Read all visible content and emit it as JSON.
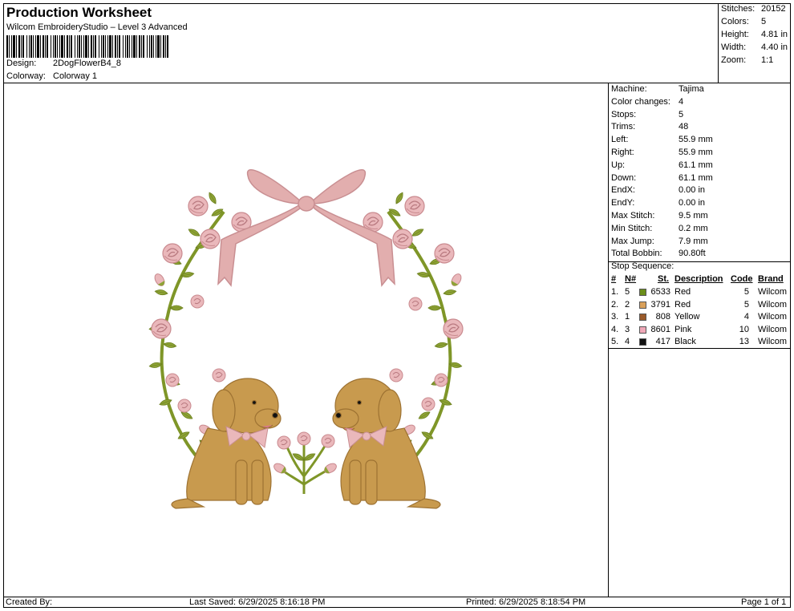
{
  "header": {
    "title": "Production Worksheet",
    "subtitle": "Wilcom EmbroideryStudio – Level 3 Advanced",
    "design_label": "Design:",
    "design_value": "2DogFlowerB4_8",
    "colorway_label": "Colorway:",
    "colorway_value": "Colorway 1"
  },
  "stats": {
    "stitches_label": "Stitches:",
    "stitches_value": "20152",
    "colors_label": "Colors:",
    "colors_value": "5",
    "height_label": "Height:",
    "height_value": "4.81 in",
    "width_label": "Width:",
    "width_value": "4.40 in",
    "zoom_label": "Zoom:",
    "zoom_value": "1:1"
  },
  "machine": [
    {
      "label": "Machine:",
      "value": "Tajima"
    },
    {
      "label": "Color changes:",
      "value": "4"
    },
    {
      "label": "Stops:",
      "value": "5"
    },
    {
      "label": "Trims:",
      "value": "48"
    },
    {
      "label": "Left:",
      "value": "55.9 mm"
    },
    {
      "label": "Right:",
      "value": "55.9 mm"
    },
    {
      "label": "Up:",
      "value": "61.1 mm"
    },
    {
      "label": "Down:",
      "value": "61.1 mm"
    },
    {
      "label": "EndX:",
      "value": "0.00 in"
    },
    {
      "label": "EndY:",
      "value": "0.00 in"
    },
    {
      "label": "Max Stitch:",
      "value": "9.5 mm"
    },
    {
      "label": "Min Stitch:",
      "value": "0.2 mm"
    },
    {
      "label": "Max Jump:",
      "value": "7.9 mm"
    },
    {
      "label": "Total Bobbin:",
      "value": "90.80ft"
    }
  ],
  "stop_sequence": {
    "title": "Stop Sequence:",
    "headers": {
      "num": "#",
      "n": "N#",
      "st": "St.",
      "desc": "Description",
      "code": "Code",
      "brand": "Brand"
    },
    "rows": [
      {
        "num": "1.",
        "n": "5",
        "st": "6533",
        "desc": "Red",
        "code": "5",
        "brand": "Wilcom",
        "color": "#6b8e1a"
      },
      {
        "num": "2.",
        "n": "2",
        "st": "3791",
        "desc": "Red",
        "code": "5",
        "brand": "Wilcom",
        "color": "#d9a05a"
      },
      {
        "num": "3.",
        "n": "1",
        "st": "808",
        "desc": "Yellow",
        "code": "4",
        "brand": "Wilcom",
        "color": "#9a5a2a"
      },
      {
        "num": "4.",
        "n": "3",
        "st": "8601",
        "desc": "Pink",
        "code": "10",
        "brand": "Wilcom",
        "color": "#f0a8b8"
      },
      {
        "num": "5.",
        "n": "4",
        "st": "417",
        "desc": "Black",
        "code": "13",
        "brand": "Wilcom",
        "color": "#111111"
      }
    ]
  },
  "footer": {
    "created_by": "Created By:",
    "last_saved": "Last Saved: 6/29/2025 8:16:18 PM",
    "printed": "Printed: 6/29/2025 8:18:54 PM",
    "page": "Page 1 of 1"
  },
  "colors": {
    "leaf": "#8ea336",
    "rose": "#eab8bb",
    "bow": "#e2aeae",
    "dog": "#c89a4e"
  }
}
